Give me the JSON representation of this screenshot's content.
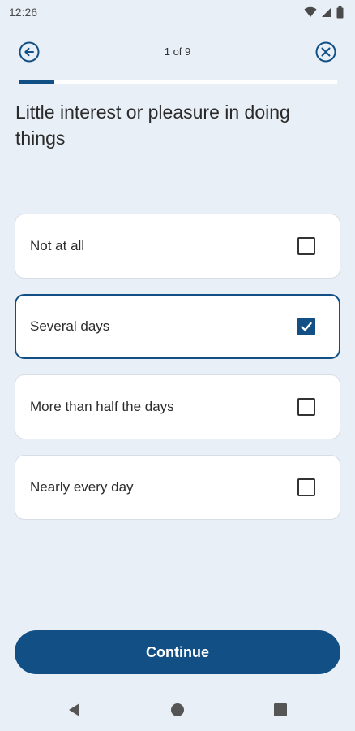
{
  "status_bar": {
    "time": "12:26",
    "icons": [
      "wifi-icon",
      "signal-icon",
      "battery-icon"
    ]
  },
  "header": {
    "step_text": "1 of 9",
    "back_icon": "back-arrow-circle-icon",
    "close_icon": "close-circle-icon"
  },
  "progress": {
    "fraction": 0.111
  },
  "question": "Little interest or pleasure in doing things",
  "options": [
    {
      "label": "Not at all",
      "checked": false
    },
    {
      "label": "Several days",
      "checked": true
    },
    {
      "label": "More than half the days",
      "checked": false
    },
    {
      "label": "Nearly every day",
      "checked": false
    }
  ],
  "continue_label": "Continue",
  "nav_bar": {
    "icons": [
      "nav-back-icon",
      "nav-home-icon",
      "nav-recents-icon"
    ]
  },
  "colors": {
    "accent": "#124f85",
    "background": "#e8eff6"
  }
}
